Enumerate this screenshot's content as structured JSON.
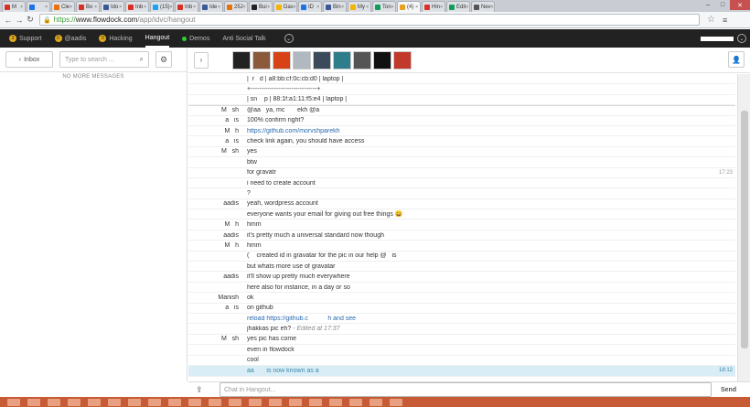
{
  "browser": {
    "tabs": [
      {
        "label": "M",
        "color": "#d93025"
      },
      {
        "label": "",
        "color": "#1a73e8"
      },
      {
        "label": "Cle",
        "color": "#e8710a"
      },
      {
        "label": "Bo",
        "color": "#d93025"
      },
      {
        "label": "Ido",
        "color": "#3b5998"
      },
      {
        "label": "Inb",
        "color": "#d93025"
      },
      {
        "label": "(15)",
        "color": "#1da1f2"
      },
      {
        "label": "Inb",
        "color": "#d93025"
      },
      {
        "label": "Ide",
        "color": "#3b5998"
      },
      {
        "label": "25J",
        "color": "#e8710a"
      },
      {
        "label": "Bui",
        "color": "#222222"
      },
      {
        "label": "Das",
        "color": "#f4b400"
      },
      {
        "label": "ID",
        "color": "#1a73e8"
      },
      {
        "label": "Bin",
        "color": "#3b5998"
      },
      {
        "label": "My",
        "color": "#f4b400"
      },
      {
        "label": "Ton",
        "color": "#0f9d58"
      },
      {
        "label": "(4)",
        "color": "#e8a020",
        "active": true
      },
      {
        "label": "Hin",
        "color": "#d93025"
      },
      {
        "label": "Edit",
        "color": "#0f9d58"
      },
      {
        "label": "Nev",
        "color": "#555555"
      }
    ],
    "url_secure": "https://",
    "url_host": "www.flowdock.com",
    "url_path": "/app/idvc/hangout"
  },
  "appnav": {
    "items": [
      {
        "label": "Support",
        "badge": "3",
        "active": false
      },
      {
        "label": "@aadis",
        "badge": "0",
        "active": false
      },
      {
        "label": "Hacking",
        "badge": "0",
        "active": false
      },
      {
        "label": "Hangout",
        "badge": "",
        "active": true
      },
      {
        "label": "Demos",
        "dot": true,
        "active": false
      },
      {
        "label": "Anti Social Talk",
        "active": false
      }
    ]
  },
  "sidebar": {
    "inbox_label": "Inbox",
    "search_placeholder": "Type to search ...",
    "no_more": "NO MORE MESSAGES"
  },
  "avatars": [
    {
      "color": "#222222"
    },
    {
      "color": "#8a5a3a"
    },
    {
      "color": "#d84315"
    },
    {
      "color": "#b0b8c0"
    },
    {
      "color": "#3a4a5a"
    },
    {
      "color": "#2e7d8a"
    },
    {
      "color": "#555555"
    },
    {
      "color": "#111111"
    },
    {
      "color": "#c0392b"
    }
  ],
  "messages": [
    {
      "name": "",
      "text": "|  r   d | a8:bb:cf:0c:cb:d0 | laptop |",
      "time": ""
    },
    {
      "name": "",
      "text": "+-------------------------------+",
      "time": ""
    },
    {
      "name": "",
      "text": "| sn    p | 88:1f:a1:11:f5:e4 | laptop |",
      "time": ""
    },
    {
      "name": "M   sh",
      "text": "@aa   ya, mc       ekh @a    ",
      "time": "",
      "first": true
    },
    {
      "name": "a   is",
      "text": "100% confirm right?",
      "time": ""
    },
    {
      "name": "M   h",
      "text": "https://github.com/morvshparekh",
      "time": "",
      "link": true
    },
    {
      "name": "a   is",
      "text": "check link again, you should have access",
      "time": ""
    },
    {
      "name": "M   sh",
      "text": "yes",
      "time": ""
    },
    {
      "name": "",
      "text": "btw",
      "time": ""
    },
    {
      "name": "",
      "text": "for gravatr",
      "time": "17:23"
    },
    {
      "name": "",
      "text": "i need to create account",
      "time": ""
    },
    {
      "name": "",
      "text": "?",
      "time": ""
    },
    {
      "name": "aadis",
      "text": "yeah, wordpress account",
      "time": ""
    },
    {
      "name": "",
      "text": "everyone wants your email for giving out free things 😄",
      "time": ""
    },
    {
      "name": "M   h",
      "text": "hmm",
      "time": ""
    },
    {
      "name": "aadis",
      "text": "it's pretty much a universal standard now though",
      "time": ""
    },
    {
      "name": "M   h",
      "text": "hmm",
      "time": ""
    },
    {
      "name": "",
      "text": "(´   created id in gravatar for the pic in our help @   is",
      "time": ""
    },
    {
      "name": "",
      "text": "but whats more use of gravatar",
      "time": ""
    },
    {
      "name": "aadis",
      "text": "it'll show up pretty much everywhere",
      "time": ""
    },
    {
      "name": "",
      "text": "here also for instance, in a day or so",
      "time": ""
    },
    {
      "name": "Manish",
      "text": "ok",
      "time": ""
    },
    {
      "name": "a   is",
      "text": "on github",
      "time": ""
    },
    {
      "name": "",
      "text": "reload https://github.c           h and see",
      "time": "",
      "link": true
    },
    {
      "name": "",
      "text": "jhakkas pic eh?",
      "edited": " - Edited at 17:37",
      "time": ""
    },
    {
      "name": "M   sh",
      "text": "yes pic has come",
      "time": ""
    },
    {
      "name": "",
      "text": "even in flowdock",
      "time": ""
    },
    {
      "name": "",
      "text": "cool",
      "time": ""
    },
    {
      "name": "",
      "text": "aa       is now known as a    ",
      "time": "18:12",
      "notice": true
    }
  ],
  "composer": {
    "placeholder": "Chat in Hangout...",
    "send_label": "Send"
  }
}
